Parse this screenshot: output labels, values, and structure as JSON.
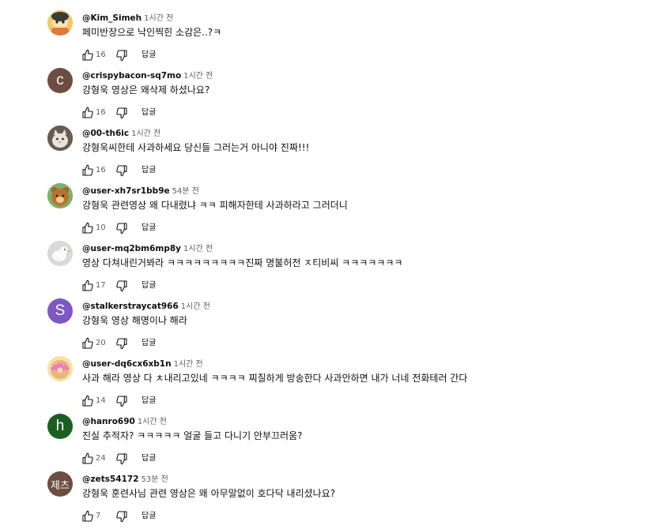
{
  "comments": [
    {
      "author": "@Kim_Simeh",
      "time": "1시간 전",
      "text": "페미반장으로 낙인찍힌 소감은..?ㅋ",
      "likes": "16",
      "reply": "답글",
      "avatar": {
        "type": "image",
        "icon": "cartoon-face-avatar",
        "bg": "#f2c96b"
      }
    },
    {
      "author": "@crispybacon-sq7mo",
      "time": "1시간 전",
      "text": "강형욱 영상은 왜삭제 하셨나요?",
      "likes": "16",
      "reply": "답글",
      "avatar": {
        "type": "letter",
        "letter": "c",
        "bg": "#6d4c41"
      }
    },
    {
      "author": "@00-th6ic",
      "time": "1시간 전",
      "text": "강형욱씨한테 사과하세요 당신들 그러는거 아니야 진짜!!!",
      "likes": "16",
      "reply": "답글",
      "avatar": {
        "type": "image",
        "icon": "cat-photo-avatar",
        "bg": "#6b5a52"
      }
    },
    {
      "author": "@user-xh7sr1bb9e",
      "time": "54분 전",
      "text": "강형욱 관련영상 왜 다내렸냐 ㅋㅋ 피해자한테 사과하라고 그러더니",
      "likes": "10",
      "reply": "답글",
      "avatar": {
        "type": "image",
        "icon": "bear-character-avatar",
        "bg": "#7fb069"
      }
    },
    {
      "author": "@user-mq2bm6mp8y",
      "time": "1시간 전",
      "text": "영상 다쳐내린거봐라 ㅋㅋㅋㅋㅋㅋㅋㅋㅋ진짜 명불허전 ㅈ티비씨 ㅋㅋㅋㅋㅋㅋㅋ",
      "likes": "17",
      "reply": "답글",
      "avatar": {
        "type": "image",
        "icon": "white-bird-avatar",
        "bg": "#d9d9d9"
      }
    },
    {
      "author": "@stalkerstraycat966",
      "time": "1시간 전",
      "text": "강형욱 영상 해명이나 해라",
      "likes": "20",
      "reply": "답글",
      "avatar": {
        "type": "letter",
        "letter": "S",
        "bg": "#7e57c2"
      }
    },
    {
      "author": "@user-dq6cx6xb1n",
      "time": "1시간 전",
      "text": "사과 해라 영상 다 ㅊ내리고있네 ㅋㅋㅋㅋ 찌질하게 방송한다 사과안하면 내가 너네 전화테러 간다",
      "likes": "14",
      "reply": "답글",
      "avatar": {
        "type": "image",
        "icon": "donut-avatar",
        "bg": "#f7e0a8"
      }
    },
    {
      "author": "@hanro690",
      "time": "1시간 전",
      "text": "진실 추적자? ㅋㅋㅋㅋㅋ 얼굴 들고 다니기 안부끄러움?",
      "likes": "24",
      "reply": "답글",
      "avatar": {
        "type": "letter",
        "letter": "h",
        "bg": "#1b5e20"
      }
    },
    {
      "author": "@zets54172",
      "time": "53분 전",
      "text": "강형욱 훈련사님 관련 영상은 왜 아무말없이 호다닥 내리셨나요?",
      "likes": "7",
      "reply": "답글",
      "avatar": {
        "type": "letter",
        "letter": "제츠",
        "bg": "#6d4c41"
      }
    }
  ],
  "icons": {
    "like": "thumbs-up-icon",
    "dislike": "thumbs-down-icon"
  }
}
